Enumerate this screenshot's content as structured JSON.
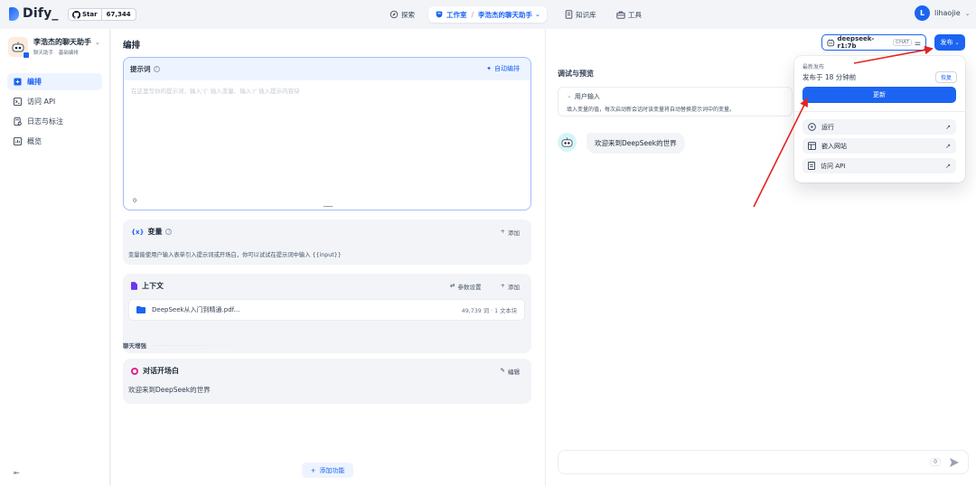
{
  "header": {
    "logo": "Dify_",
    "star_label": "Star",
    "star_count": "67,344",
    "nav_explore": "探索",
    "nav_studio": "工作室",
    "nav_app": "李浩杰的聊天助手",
    "nav_knowledge": "知识库",
    "nav_tools": "工具",
    "user_initial": "L",
    "user_name": "lihaojie"
  },
  "sidebar": {
    "app_name": "李浩杰的聊天助手",
    "app_type": "聊天助手",
    "app_mode": "基础编排",
    "items": [
      {
        "label": "编排",
        "icon": "orchestrate-icon"
      },
      {
        "label": "访问 API",
        "icon": "terminal-icon"
      },
      {
        "label": "日志与标注",
        "icon": "log-icon"
      },
      {
        "label": "概览",
        "icon": "chart-icon"
      }
    ]
  },
  "editor": {
    "title": "编排",
    "prompt_label": "提示词",
    "auto_arrange": "自动编排",
    "prompt_placeholder": "在这里写你的提示词，输入'{' 插入变量、输入'/' 插入提示内容块",
    "prompt_count": "0",
    "variables_label": "变量",
    "add_label": "添加",
    "variables_desc": "变量能使用户输入表单引入提示词或开场白，你可以试试在提示词中输入 {{input}}",
    "context_label": "上下文",
    "param_settings": "参数设置",
    "doc_name": "DeepSeek从入门到精通.pdf...",
    "doc_meta": "49,739 词 · 1 文本块",
    "chat_enhance": "聊天增强",
    "opening_label": "对话开场白",
    "edit_label": "编辑",
    "opening_text": "欢迎来到DeepSeek的世界",
    "add_feature": "添加功能"
  },
  "preview": {
    "title": "调试与预览",
    "user_input_label": "用户输入",
    "user_input_desc": "填入变量的值，每次启动新会话时该变量将自动替换提示词中的变量。",
    "welcome": "欢迎来到DeepSeek的世界",
    "input_count": "0"
  },
  "toolbar": {
    "model_name": "deepseek-r1:7b",
    "model_badge": "CHAT",
    "publish_label": "发布"
  },
  "publish_menu": {
    "latest_label": "最新发布",
    "published_time": "发布于 18 分钟前",
    "restore_label": "恢复",
    "update_label": "更新",
    "run_label": "运行",
    "embed_label": "嵌入网站",
    "api_label": "访问 API"
  },
  "colors": {
    "primary": "#1c64f2",
    "annotation_arrow": "#e5231f"
  }
}
